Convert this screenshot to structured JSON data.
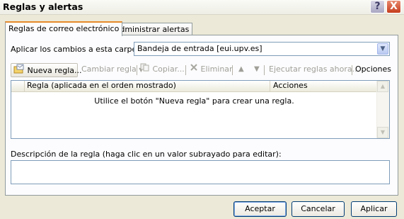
{
  "window": {
    "title": "Reglas y alertas",
    "help_icon": "?",
    "close_icon": "X"
  },
  "tabs": [
    {
      "label": "Reglas de correo electrónico",
      "active": true
    },
    {
      "label": "Administrar alertas",
      "active": false
    }
  ],
  "apply_folder": {
    "label": "Aplicar los cambios a esta carpeta:",
    "value": "Bandeja de entrada [eui.upv.es]"
  },
  "toolbar": {
    "new_rule": "Nueva regla...",
    "change_rule": "Cambiar regla",
    "copy": "Copiar...",
    "delete": "Eliminar",
    "run_rules": "Ejecutar reglas ahora...",
    "options": "Opciones"
  },
  "rules_list": {
    "columns": [
      "Regla (aplicada en el orden mostrado)",
      "Acciones"
    ],
    "empty_message": "Utilice el botón \"Nueva regla\" para crear una regla."
  },
  "description": {
    "label": "Descripción de la regla (haga clic en un valor subrayado para editar):"
  },
  "buttons": {
    "ok": "Aceptar",
    "cancel": "Cancelar",
    "apply": "Aplicar"
  },
  "colors": {
    "tab_accent": "#e68b2c",
    "close": "#c53e1d",
    "field_border": "#7f9db9"
  }
}
